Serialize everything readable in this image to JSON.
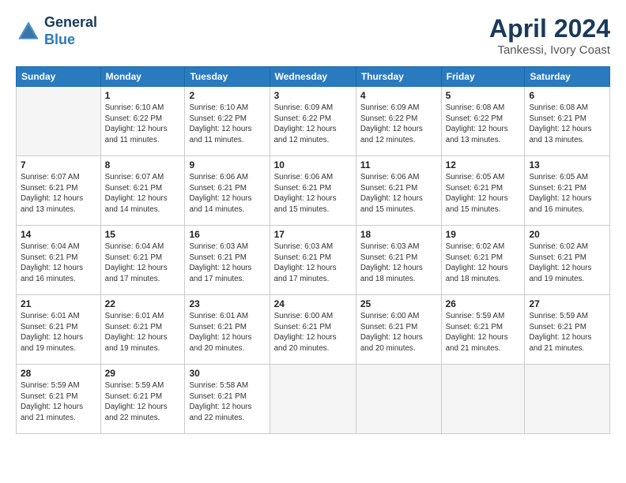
{
  "header": {
    "logo_line1": "General",
    "logo_line2": "Blue",
    "month_year": "April 2024",
    "location": "Tankessi, Ivory Coast"
  },
  "columns": [
    "Sunday",
    "Monday",
    "Tuesday",
    "Wednesday",
    "Thursday",
    "Friday",
    "Saturday"
  ],
  "weeks": [
    [
      {
        "num": "",
        "info": ""
      },
      {
        "num": "1",
        "info": "Sunrise: 6:10 AM\nSunset: 6:22 PM\nDaylight: 12 hours\nand 11 minutes."
      },
      {
        "num": "2",
        "info": "Sunrise: 6:10 AM\nSunset: 6:22 PM\nDaylight: 12 hours\nand 11 minutes."
      },
      {
        "num": "3",
        "info": "Sunrise: 6:09 AM\nSunset: 6:22 PM\nDaylight: 12 hours\nand 12 minutes."
      },
      {
        "num": "4",
        "info": "Sunrise: 6:09 AM\nSunset: 6:22 PM\nDaylight: 12 hours\nand 12 minutes."
      },
      {
        "num": "5",
        "info": "Sunrise: 6:08 AM\nSunset: 6:22 PM\nDaylight: 12 hours\nand 13 minutes."
      },
      {
        "num": "6",
        "info": "Sunrise: 6:08 AM\nSunset: 6:21 PM\nDaylight: 12 hours\nand 13 minutes."
      }
    ],
    [
      {
        "num": "7",
        "info": "Sunrise: 6:07 AM\nSunset: 6:21 PM\nDaylight: 12 hours\nand 13 minutes."
      },
      {
        "num": "8",
        "info": "Sunrise: 6:07 AM\nSunset: 6:21 PM\nDaylight: 12 hours\nand 14 minutes."
      },
      {
        "num": "9",
        "info": "Sunrise: 6:06 AM\nSunset: 6:21 PM\nDaylight: 12 hours\nand 14 minutes."
      },
      {
        "num": "10",
        "info": "Sunrise: 6:06 AM\nSunset: 6:21 PM\nDaylight: 12 hours\nand 15 minutes."
      },
      {
        "num": "11",
        "info": "Sunrise: 6:06 AM\nSunset: 6:21 PM\nDaylight: 12 hours\nand 15 minutes."
      },
      {
        "num": "12",
        "info": "Sunrise: 6:05 AM\nSunset: 6:21 PM\nDaylight: 12 hours\nand 15 minutes."
      },
      {
        "num": "13",
        "info": "Sunrise: 6:05 AM\nSunset: 6:21 PM\nDaylight: 12 hours\nand 16 minutes."
      }
    ],
    [
      {
        "num": "14",
        "info": "Sunrise: 6:04 AM\nSunset: 6:21 PM\nDaylight: 12 hours\nand 16 minutes."
      },
      {
        "num": "15",
        "info": "Sunrise: 6:04 AM\nSunset: 6:21 PM\nDaylight: 12 hours\nand 17 minutes."
      },
      {
        "num": "16",
        "info": "Sunrise: 6:03 AM\nSunset: 6:21 PM\nDaylight: 12 hours\nand 17 minutes."
      },
      {
        "num": "17",
        "info": "Sunrise: 6:03 AM\nSunset: 6:21 PM\nDaylight: 12 hours\nand 17 minutes."
      },
      {
        "num": "18",
        "info": "Sunrise: 6:03 AM\nSunset: 6:21 PM\nDaylight: 12 hours\nand 18 minutes."
      },
      {
        "num": "19",
        "info": "Sunrise: 6:02 AM\nSunset: 6:21 PM\nDaylight: 12 hours\nand 18 minutes."
      },
      {
        "num": "20",
        "info": "Sunrise: 6:02 AM\nSunset: 6:21 PM\nDaylight: 12 hours\nand 19 minutes."
      }
    ],
    [
      {
        "num": "21",
        "info": "Sunrise: 6:01 AM\nSunset: 6:21 PM\nDaylight: 12 hours\nand 19 minutes."
      },
      {
        "num": "22",
        "info": "Sunrise: 6:01 AM\nSunset: 6:21 PM\nDaylight: 12 hours\nand 19 minutes."
      },
      {
        "num": "23",
        "info": "Sunrise: 6:01 AM\nSunset: 6:21 PM\nDaylight: 12 hours\nand 20 minutes."
      },
      {
        "num": "24",
        "info": "Sunrise: 6:00 AM\nSunset: 6:21 PM\nDaylight: 12 hours\nand 20 minutes."
      },
      {
        "num": "25",
        "info": "Sunrise: 6:00 AM\nSunset: 6:21 PM\nDaylight: 12 hours\nand 20 minutes."
      },
      {
        "num": "26",
        "info": "Sunrise: 5:59 AM\nSunset: 6:21 PM\nDaylight: 12 hours\nand 21 minutes."
      },
      {
        "num": "27",
        "info": "Sunrise: 5:59 AM\nSunset: 6:21 PM\nDaylight: 12 hours\nand 21 minutes."
      }
    ],
    [
      {
        "num": "28",
        "info": "Sunrise: 5:59 AM\nSunset: 6:21 PM\nDaylight: 12 hours\nand 21 minutes."
      },
      {
        "num": "29",
        "info": "Sunrise: 5:59 AM\nSunset: 6:21 PM\nDaylight: 12 hours\nand 22 minutes."
      },
      {
        "num": "30",
        "info": "Sunrise: 5:58 AM\nSunset: 6:21 PM\nDaylight: 12 hours\nand 22 minutes."
      },
      {
        "num": "",
        "info": ""
      },
      {
        "num": "",
        "info": ""
      },
      {
        "num": "",
        "info": ""
      },
      {
        "num": "",
        "info": ""
      }
    ]
  ]
}
